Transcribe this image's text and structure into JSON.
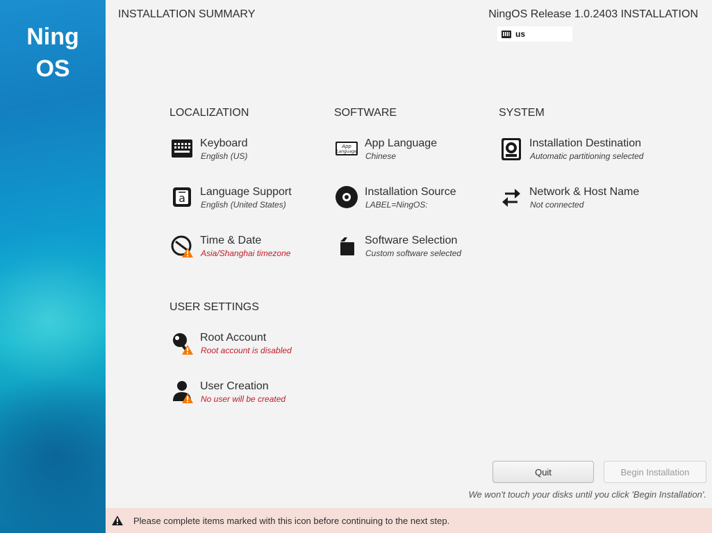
{
  "sidebar": {
    "logo_line1": "Ning",
    "logo_line2": "OS"
  },
  "header": {
    "title": "INSTALLATION SUMMARY",
    "release": "NingOS Release 1.0.2403 INSTALLATION",
    "keyboard_layout": "us"
  },
  "sections": {
    "localization": "LOCALIZATION",
    "software": "SOFTWARE",
    "system": "SYSTEM",
    "user_settings": "USER SETTINGS"
  },
  "spokes": {
    "keyboard": {
      "name": "Keyboard",
      "status": "English (US)",
      "icon": "keyboard-icon"
    },
    "language_support": {
      "name": "Language Support",
      "status": "English (United States)",
      "icon": "language-icon"
    },
    "time_date": {
      "name": "Time & Date",
      "status": "Asia/Shanghai timezone",
      "icon": "clock-icon",
      "warning": true
    },
    "app_language": {
      "name": "App Language",
      "status": "Chinese",
      "icon": "app-language-icon",
      "icon_text_1": "App",
      "icon_text_2": "Language"
    },
    "installation_source": {
      "name": "Installation Source",
      "status": "LABEL=NingOS:",
      "icon": "disc-icon"
    },
    "software_selection": {
      "name": "Software Selection",
      "status": "Custom software selected",
      "icon": "package-icon"
    },
    "installation_destination": {
      "name": "Installation Destination",
      "status": "Automatic partitioning selected",
      "icon": "harddisk-icon"
    },
    "network": {
      "name": "Network & Host Name",
      "status": "Not connected",
      "icon": "network-arrows-icon"
    },
    "root_account": {
      "name": "Root Account",
      "status": "Root account is disabled",
      "icon": "key-icon",
      "warning": true
    },
    "user_creation": {
      "name": "User Creation",
      "status": "No user will be created",
      "icon": "user-icon",
      "warning": true
    }
  },
  "buttons": {
    "quit": "Quit",
    "begin": "Begin Installation"
  },
  "disk_note": "We won't touch your disks until you click 'Begin Installation'.",
  "warning_bar": "Please complete items marked with this icon before continuing to the next step.",
  "colors": {
    "warning_text": "#c01c28",
    "warning_icon": "#f57900",
    "warning_bar_bg": "#f6dfd9"
  }
}
